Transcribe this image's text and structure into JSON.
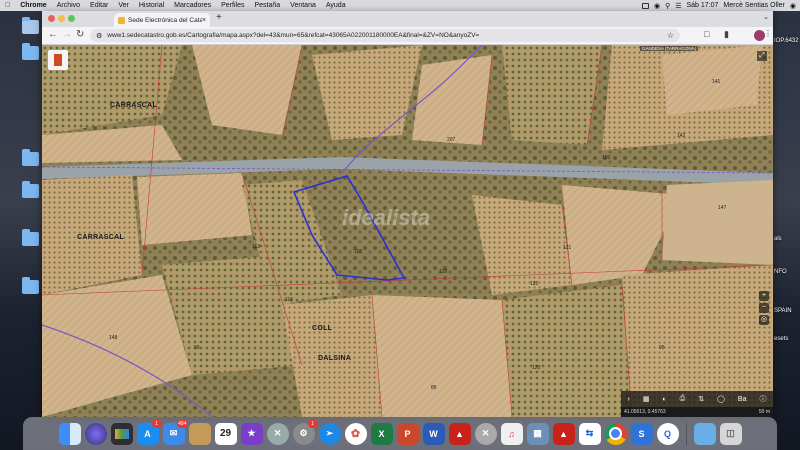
{
  "menubar": {
    "app": "Chrome",
    "items": [
      "Archivo",
      "Editar",
      "Ver",
      "Historial",
      "Marcadores",
      "Perfiles",
      "Pestaña",
      "Ventana",
      "Ayuda"
    ],
    "clock": "Sáb 17:07",
    "user": "Mercè Sentias Oller"
  },
  "browser": {
    "tab_title": "Sede Electrónica del Catastro",
    "url": "www1.sedecatastro.gob.es/Cartografia/mapa.aspx?del=43&mun=65&refcat=43065A022001180000EA&final=&ZV=NO&anyoZV="
  },
  "map": {
    "top_label": "GANDESA (TARRAGONA)",
    "places": [
      {
        "name": "CARRASCAL"
      },
      {
        "name": "CARRASCAL"
      },
      {
        "name": "COLL"
      },
      {
        "name": "DALSINA"
      }
    ],
    "parcels": [
      "207",
      "141",
      "142",
      "113",
      "116",
      "118",
      "128",
      "125",
      "120",
      "121",
      "85",
      "95",
      "99",
      "148",
      "147",
      "103"
    ],
    "watermark": "idealista",
    "status_left": "41.05613, 0.45763",
    "scale": "50 m",
    "zoom_label": "Ba"
  },
  "desktop": {
    "right_labels": [
      "als",
      "NFO",
      "SPAIN",
      "esets",
      "IOP.6432"
    ]
  },
  "dock": {
    "badges": {
      "appstore": "1",
      "mail": "494",
      "sysprefs": "1"
    },
    "calendar_day": "29"
  },
  "colors": {
    "parcel_outline": "#2a2fd6",
    "road": "#9aa3a8",
    "boundary": "#7a55c8"
  }
}
